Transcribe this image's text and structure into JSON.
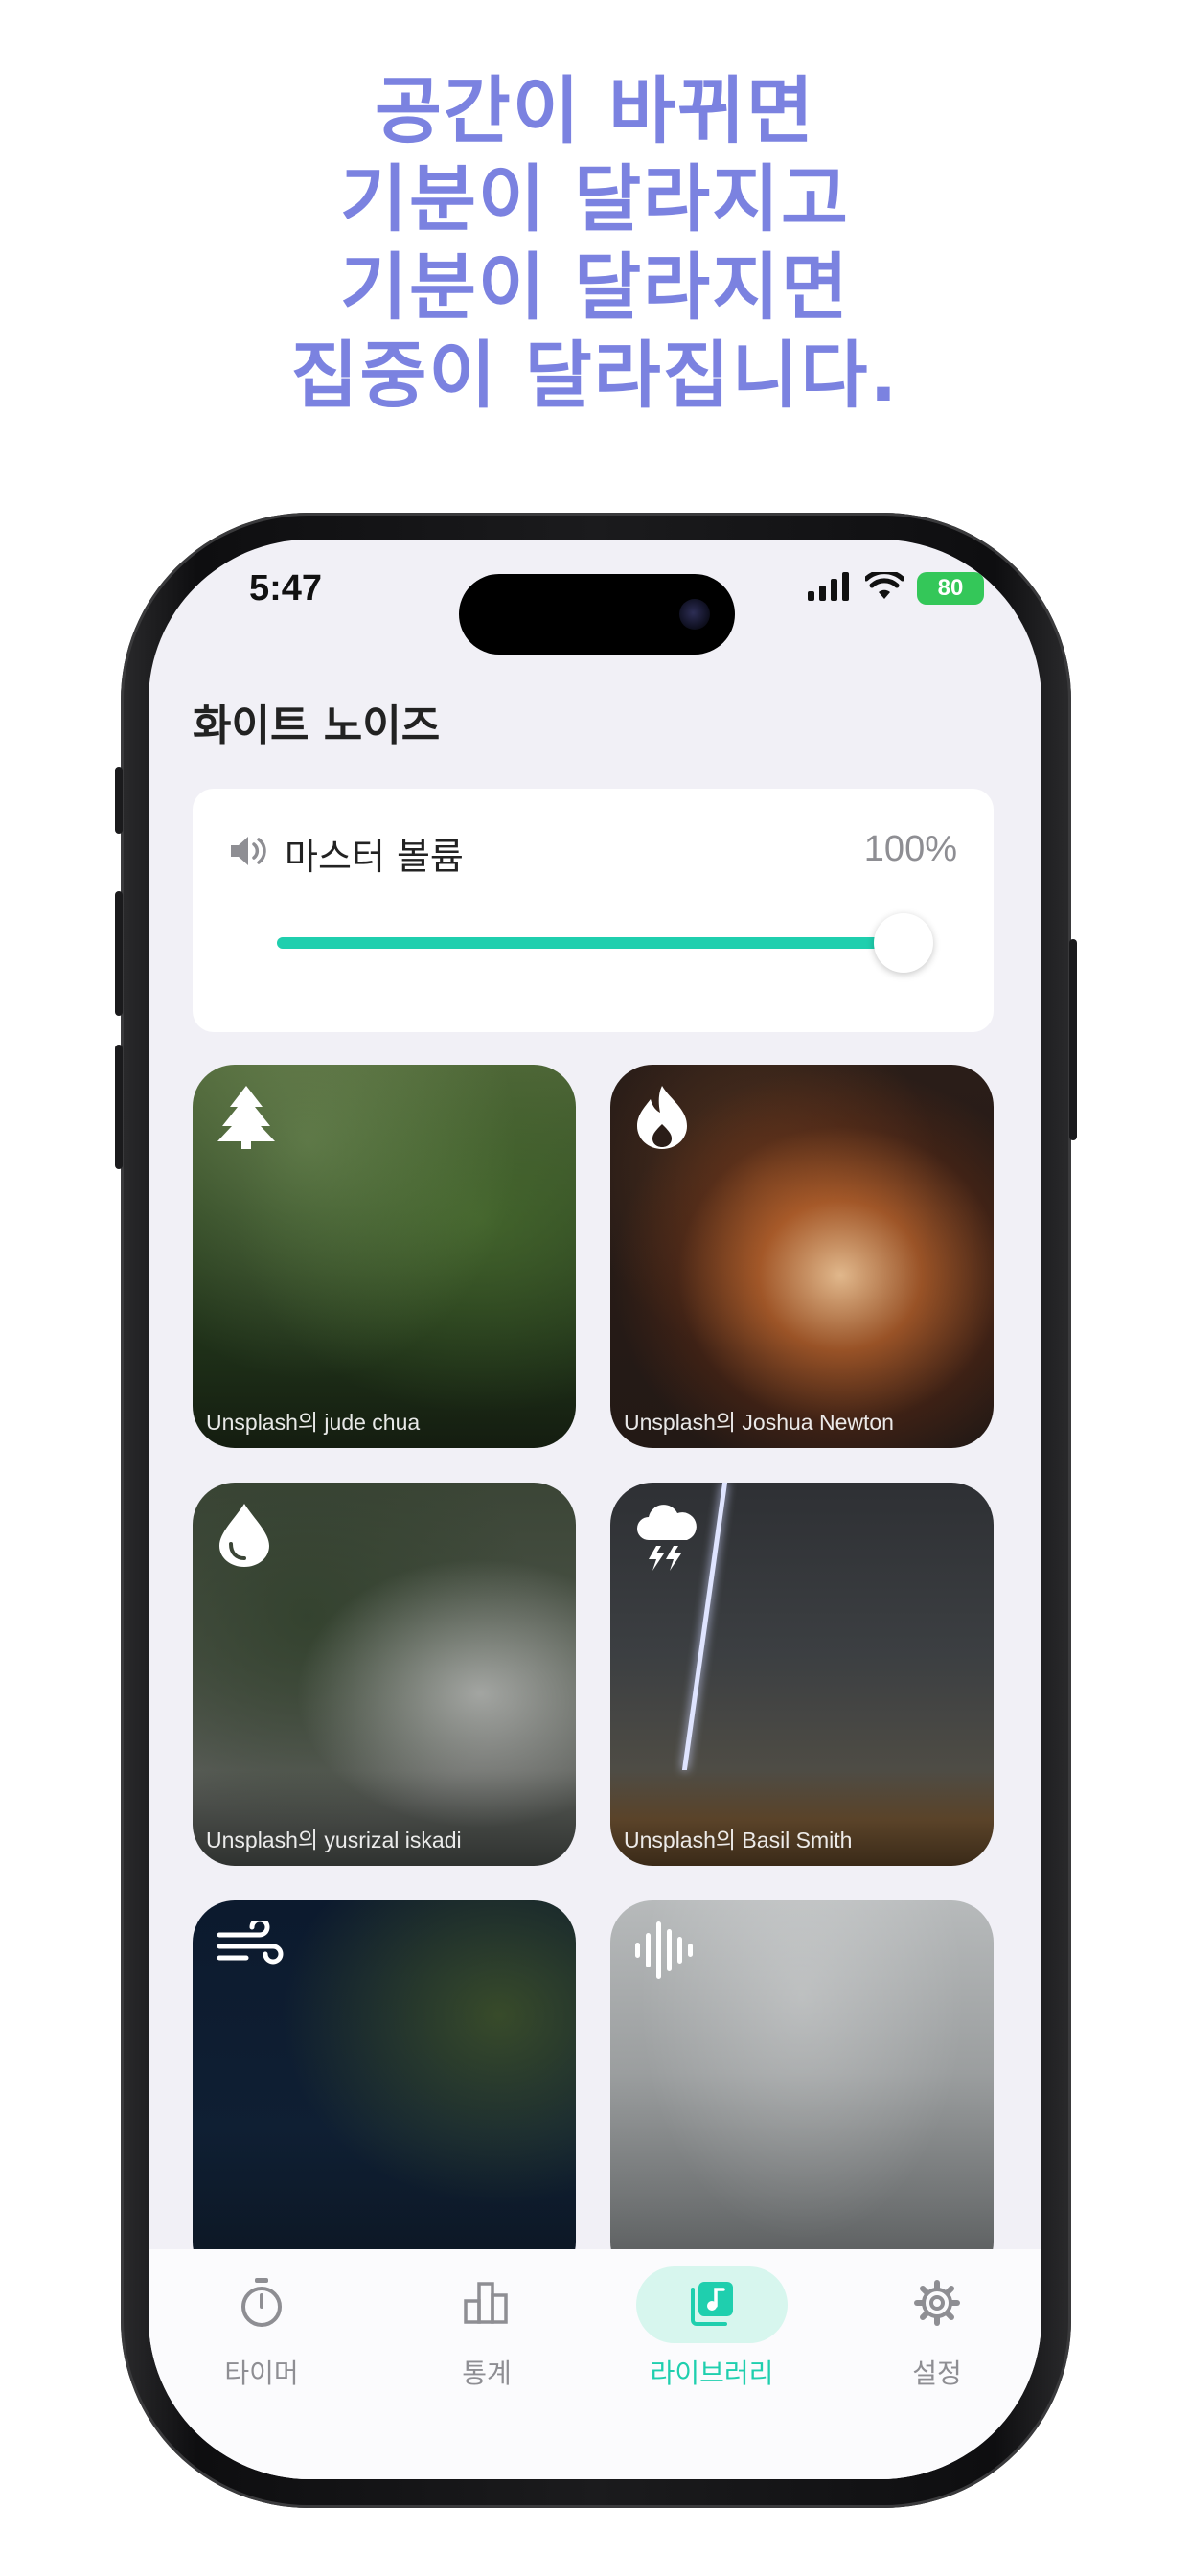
{
  "headline": {
    "line1": "공간이 바뀌면",
    "line2": "기분이 달라지고",
    "line3": "기분이 달라지면",
    "line4": "집중이 달라집니다."
  },
  "status": {
    "time": "5:47",
    "battery": "80"
  },
  "page": {
    "title": "화이트 노이즈"
  },
  "volume": {
    "label": "마스터 볼륨",
    "value_text": "100%",
    "level": 1.0,
    "icon": "speaker-icon"
  },
  "tiles": [
    {
      "icon": "tree-icon",
      "credit": "Unsplash의 jude chua"
    },
    {
      "icon": "fire-icon",
      "credit": "Unsplash의 Joshua Newton"
    },
    {
      "icon": "water-drop-icon",
      "credit": "Unsplash의 yusrizal iskadi"
    },
    {
      "icon": "thunderstorm-icon",
      "credit": "Unsplash의 Basil Smith"
    },
    {
      "icon": "wind-icon",
      "credit": ""
    },
    {
      "icon": "sound-wave-icon",
      "credit": ""
    }
  ],
  "tabbar": {
    "items": [
      {
        "label": "타이머",
        "icon": "stopwatch-icon"
      },
      {
        "label": "통계",
        "icon": "bar-chart-icon"
      },
      {
        "label": "라이브러리",
        "icon": "music-library-icon",
        "active": true
      },
      {
        "label": "설정",
        "icon": "gear-icon"
      }
    ]
  },
  "colors": {
    "headline": "#7b82e0",
    "accent": "#1fcfae",
    "accent_bg": "#d7f6ee"
  }
}
